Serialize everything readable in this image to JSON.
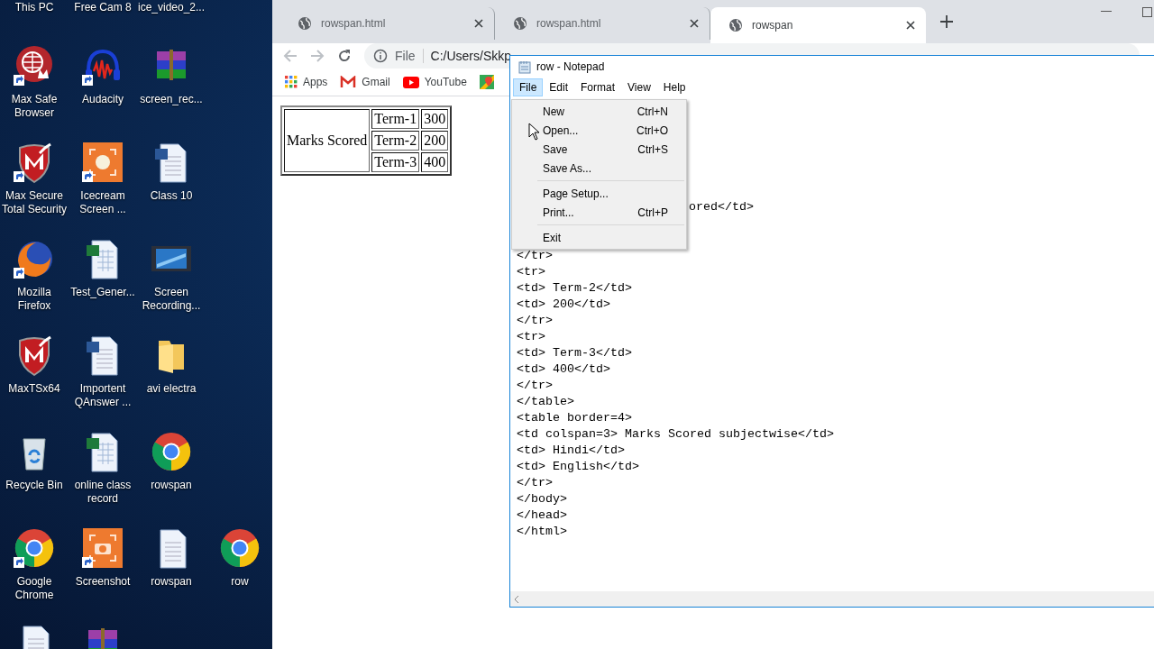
{
  "desktop": {
    "rows": [
      [
        {
          "label": "This PC"
        },
        {
          "label": "Free Cam 8"
        },
        {
          "label": "ice_video_2..."
        }
      ],
      [
        {
          "kind": "globe-badge",
          "shortcut": true,
          "label": "Max Safe Browser"
        },
        {
          "kind": "headphones",
          "shortcut": true,
          "label": "Audacity"
        },
        {
          "kind": "archive",
          "shortcut": false,
          "label": "screen_rec..."
        }
      ],
      [
        {
          "kind": "shield",
          "shortcut": true,
          "label": "Max Secure Total Security"
        },
        {
          "kind": "record",
          "shortcut": true,
          "label": "Icecream Screen ..."
        },
        {
          "kind": "word",
          "shortcut": false,
          "label": "Class 10"
        }
      ],
      [
        {
          "kind": "fox",
          "shortcut": true,
          "label": "Mozilla Firefox"
        },
        {
          "kind": "excel",
          "shortcut": false,
          "label": "Test_Gener..."
        },
        {
          "kind": "film",
          "shortcut": false,
          "label": "Screen Recording..."
        }
      ],
      [
        {
          "kind": "shield",
          "shortcut": false,
          "label": "MaxTSx64"
        },
        {
          "kind": "word",
          "shortcut": false,
          "label": "Importent QAnswer ..."
        },
        {
          "kind": "folder",
          "shortcut": false,
          "label": "avi electra"
        }
      ],
      [
        {
          "kind": "recycle",
          "shortcut": false,
          "label": "Recycle Bin"
        },
        {
          "kind": "excel",
          "shortcut": false,
          "label": "online class record"
        },
        {
          "kind": "chrome",
          "shortcut": false,
          "label": "rowspan"
        }
      ],
      [
        {
          "kind": "chrome",
          "shortcut": true,
          "label": "Google Chrome"
        },
        {
          "kind": "camera",
          "shortcut": true,
          "label": "Screenshot"
        },
        {
          "kind": "textfile",
          "shortcut": false,
          "label": "rowspan"
        },
        {
          "kind": "chrome",
          "shortcut": false,
          "label": "row"
        }
      ],
      [
        {
          "kind": "textfile",
          "shortcut": false
        },
        {
          "kind": "archive",
          "shortcut": false
        }
      ]
    ]
  },
  "browser": {
    "tabs": [
      {
        "title": "rowspan.html",
        "selected": false
      },
      {
        "title": "rowspan.html",
        "selected": false
      },
      {
        "title": "rowspan",
        "selected": true
      }
    ],
    "address": {
      "scheme": "File",
      "url": "C:/Users/Skkp"
    },
    "bookmarks": [
      {
        "kind": "apps",
        "label": "Apps"
      },
      {
        "kind": "gmail",
        "label": "Gmail"
      },
      {
        "kind": "youtube",
        "label": "YouTube"
      },
      {
        "kind": "maps"
      }
    ],
    "table": {
      "header": "Marks Scored",
      "rows": [
        {
          "term": "Term-1",
          "marks": "300"
        },
        {
          "term": "Term-2",
          "marks": "200"
        },
        {
          "term": "Term-3",
          "marks": "400"
        }
      ]
    }
  },
  "notepad": {
    "title": "row - Notepad",
    "menus": [
      {
        "label": "File",
        "selected": true
      },
      {
        "label": "Edit",
        "selected": false
      },
      {
        "label": "Format",
        "selected": false
      },
      {
        "label": "View",
        "selected": false
      },
      {
        "label": "Help",
        "selected": false
      }
    ],
    "open_menu": [
      {
        "kind": "item",
        "label": "New",
        "shortcut": "Ctrl+N"
      },
      {
        "kind": "item",
        "label": "Open...",
        "shortcut": "Ctrl+O"
      },
      {
        "kind": "item",
        "label": "Save",
        "shortcut": "Ctrl+S"
      },
      {
        "kind": "item",
        "label": "Save As..."
      },
      {
        "kind": "separator"
      },
      {
        "kind": "item",
        "label": "Page Setup..."
      },
      {
        "kind": "item",
        "label": "Print...",
        "shortcut": "Ctrl+P"
      },
      {
        "kind": "separator"
      },
      {
        "kind": "item",
        "label": "Exit"
      }
    ],
    "partial_line": "ored</td>",
    "lines": [
      "</tr>",
      "<tr>",
      "<td> Term-2</td>",
      "<td> 200</td>",
      "</tr>",
      "<tr>",
      "<td> Term-3</td>",
      "<td> 400</td>",
      "</tr>",
      "</table>",
      "<table border=4>",
      "<td colspan=3> Marks Scored subjectwise</td>",
      "<td> Hindi</td>",
      "<td> English</td>",
      "</tr>",
      "</body>",
      "</head>",
      "</html>"
    ]
  }
}
